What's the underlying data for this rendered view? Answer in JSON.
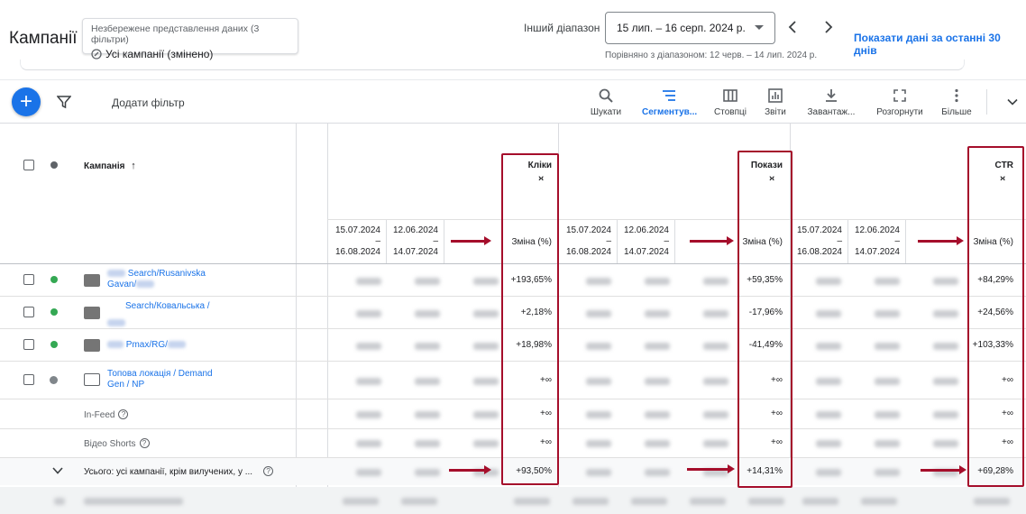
{
  "header": {
    "title": "Кампанії",
    "view_note": "Незбережене представлення даних (3 фільтри)",
    "view_name": "Усі кампанії (змінено)",
    "range_label": "Інший діапазон",
    "date_range": "15 лип. – 16 серп. 2024 р.",
    "compare_text": "Порівняно з діапазоном: 12 черв. – 14 лип. 2024 р.",
    "last30_link": "Показати дані за останні 30 днів"
  },
  "toolbar": {
    "add_filter": "Додати фільтр",
    "tools": [
      {
        "label": "Шукати",
        "icon": "search-icon"
      },
      {
        "label": "Сегментув...",
        "icon": "segment-icon"
      },
      {
        "label": "Стовпці",
        "icon": "columns-icon"
      },
      {
        "label": "Звіти",
        "icon": "reports-icon"
      },
      {
        "label": "Завантаж...",
        "icon": "download-icon"
      },
      {
        "label": "Розгорнути",
        "icon": "expand-icon"
      },
      {
        "label": "Більше",
        "icon": "more-vert-icon"
      }
    ]
  },
  "table": {
    "campaign_header": "Кампанія",
    "metric_groups": [
      {
        "name": "Кліки",
        "period1": [
          "15.07.2024",
          "–",
          "16.08.2024"
        ],
        "period2": [
          "12.06.2024",
          "–",
          "14.07.2024"
        ],
        "change_header": "Зміна (%)"
      },
      {
        "name": "Покази",
        "period1": [
          "15.07.2024",
          "–",
          "16.08.2024"
        ],
        "period2": [
          "12.06.2024",
          "–",
          "14.07.2024"
        ],
        "change_header": "Зміна (%)"
      },
      {
        "name": "CTR",
        "period1": [
          "15.07.2024",
          "–",
          "16.08.2024"
        ],
        "period2": [
          "12.06.2024",
          "–",
          "14.07.2024"
        ],
        "change_header": "Зміна (%)"
      }
    ],
    "rows": [
      {
        "name_line1": "Search/Rusanivska",
        "name_line2": "Gavan/",
        "type": "search",
        "status": "enabled",
        "clicks_change": "+193,65%",
        "impr_change": "+59,35%",
        "ctr_change": "+84,29%"
      },
      {
        "name_line1": "Search/Ковальська /",
        "name_line2": "",
        "type": "search",
        "status": "enabled",
        "clicks_change": "+2,18%",
        "impr_change": "-17,96%",
        "ctr_change": "+24,56%"
      },
      {
        "name_line1": "Pmax/RG/",
        "name_line2": "",
        "type": "pmax",
        "status": "enabled",
        "clicks_change": "+18,98%",
        "impr_change": "-41,49%",
        "ctr_change": "+103,33%"
      },
      {
        "name_line1": "Топова локація / Demand",
        "name_line2": "Gen / NP",
        "type": "demand-gen",
        "status": "paused",
        "clicks_change": "+∞",
        "impr_change": "+∞",
        "ctr_change": "+∞"
      }
    ],
    "sub_rows": [
      {
        "label": "In-Feed",
        "clicks_change": "+∞",
        "impr_change": "+∞",
        "ctr_change": "+∞"
      },
      {
        "label": "Відео Shorts",
        "clicks_change": "+∞",
        "impr_change": "+∞",
        "ctr_change": "+∞"
      }
    ],
    "total": {
      "label": "Усього: усі кампанії, крім вилучених, у ...",
      "clicks_change": "+93,50%",
      "impr_change": "+14,31%",
      "ctr_change": "+69,28%"
    }
  },
  "colors": {
    "accent": "#1a73e8",
    "annotation": "#a50e2b",
    "enabled": "#34a853"
  }
}
